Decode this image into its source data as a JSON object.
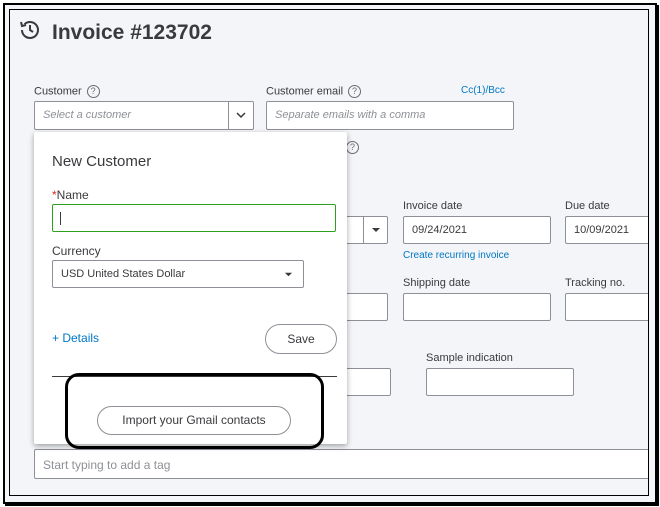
{
  "header": {
    "title": "Invoice #123702",
    "icon": "history-clock-icon"
  },
  "customer": {
    "label": "Customer",
    "placeholder": "Select a customer"
  },
  "customer_email": {
    "label": "Customer email",
    "placeholder": "Separate emails with a comma",
    "cc_link": "Cc(1)/Bcc"
  },
  "invoice_date": {
    "label": "Invoice date",
    "value": "09/24/2021",
    "recurring_link": "Create recurring invoice"
  },
  "due_date": {
    "label": "Due date",
    "value": "10/09/2021"
  },
  "shipping_date": {
    "label": "Shipping date"
  },
  "tracking_no": {
    "label": "Tracking no."
  },
  "sample_indication": {
    "label": "Sample indication"
  },
  "tags": {
    "placeholder": "Start typing to add a tag"
  },
  "new_customer": {
    "title": "New Customer",
    "name_required": "*",
    "name_label": "Name",
    "name_value": "",
    "currency_label": "Currency",
    "currency_value": "USD United States Dollar",
    "details_link": "+ Details",
    "save_label": "Save",
    "import_label": "Import your Gmail contacts"
  },
  "colors": {
    "accent_link": "#0077c5",
    "focus_green": "#2ca01c",
    "required_red": "#d52b1e",
    "callout": "#000000"
  }
}
